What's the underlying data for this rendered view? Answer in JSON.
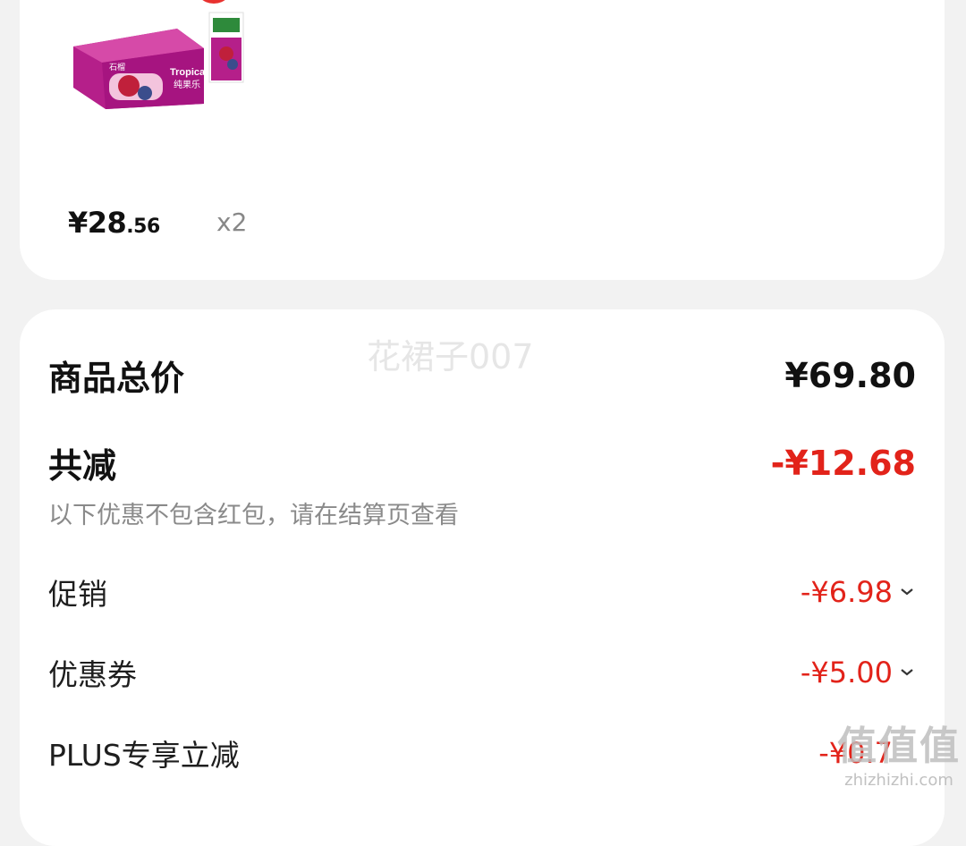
{
  "product": {
    "image_icon": "juice-box-product-image",
    "selected": true,
    "price_main": "¥28",
    "price_cents": ".56",
    "quantity": "x2",
    "brand_text": "Tropicana",
    "pack_text": "纯果乐",
    "flavor_text": "石榴"
  },
  "summary": {
    "watermark": "花裙子007",
    "total_label": "商品总价",
    "total_value": "¥69.80",
    "discount_label": "共减",
    "discount_value": "-¥12.68",
    "note": "以下优惠不包含红包，请在结算页查看",
    "rows": [
      {
        "label": "促销",
        "value": "-¥6.98"
      },
      {
        "label": "优惠券",
        "value": "-¥5.00"
      },
      {
        "label": "PLUS专享立减",
        "value": "-¥0.7"
      }
    ]
  },
  "site_watermark": {
    "cn": "值值值",
    "url": "zhizhizhi.com"
  },
  "colors": {
    "accent_red": "#e2231a",
    "check_red": "#e8322f",
    "background": "#f2f2f2"
  }
}
